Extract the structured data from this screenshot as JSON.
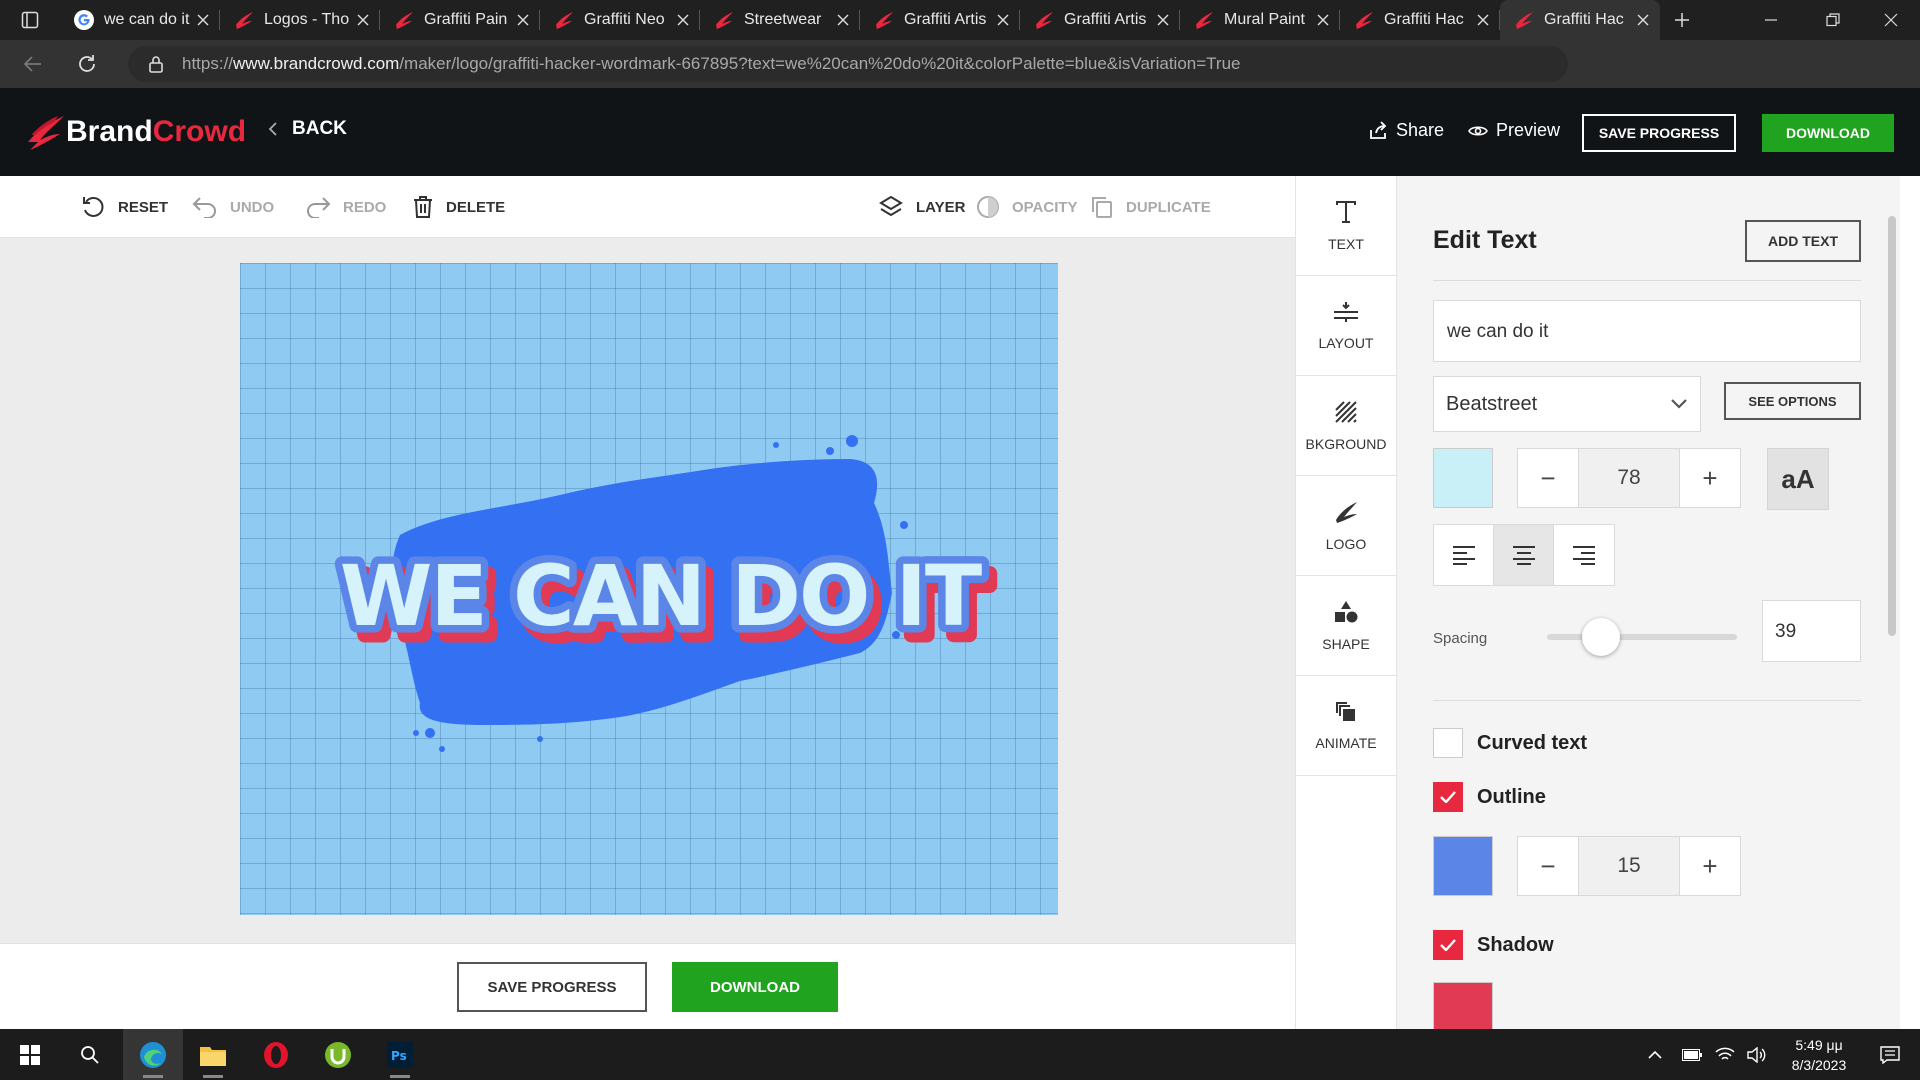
{
  "browser": {
    "tabs": [
      {
        "title": "we can do it",
        "icon": "google-g-icon",
        "active": false
      },
      {
        "title": "Logos - Tho",
        "icon": "brandcrowd-favicon-icon",
        "active": false
      },
      {
        "title": "Graffiti Pain",
        "icon": "brandcrowd-favicon-icon",
        "active": false
      },
      {
        "title": "Graffiti Neo",
        "icon": "brandcrowd-favicon-icon",
        "active": false
      },
      {
        "title": "Streetwear",
        "icon": "brandcrowd-favicon-icon",
        "active": false
      },
      {
        "title": "Graffiti Artis",
        "icon": "brandcrowd-favicon-icon",
        "active": false
      },
      {
        "title": "Graffiti Artis",
        "icon": "brandcrowd-favicon-icon",
        "active": false
      },
      {
        "title": "Mural Paint",
        "icon": "brandcrowd-favicon-icon",
        "active": false
      },
      {
        "title": "Graffiti Hac",
        "icon": "brandcrowd-favicon-icon",
        "active": false
      },
      {
        "title": "Graffiti Hac",
        "icon": "brandcrowd-favicon-icon",
        "active": true
      }
    ],
    "url_prefix": "https://",
    "url_domain": "www.brandcrowd.com",
    "url_path": "/maker/logo/graffiti-hacker-wordmark-667895?text=we%20can%20do%20it&colorPalette=blue&isVariation=True"
  },
  "header": {
    "logo_part1": "Brand",
    "logo_part2": "Crowd",
    "back_label": "BACK",
    "share_label": "Share",
    "preview_label": "Preview",
    "save_label": "SAVE PROGRESS",
    "download_label": "DOWNLOAD",
    "brand_color": "#e8283f",
    "download_color": "#20a31f"
  },
  "toolbar": {
    "reset": "RESET",
    "undo": "UNDO",
    "redo": "REDO",
    "delete": "DELETE",
    "layer": "LAYER",
    "opacity": "OPACITY",
    "duplicate": "DUPLICATE"
  },
  "canvas": {
    "logo_text": "WE CAN DO IT",
    "background_color": "#8fcaf3",
    "splash_color": "#3470f2"
  },
  "bottom": {
    "save_label": "SAVE PROGRESS",
    "download_label": "DOWNLOAD"
  },
  "rail": [
    {
      "label": "TEXT",
      "icon": "text-icon"
    },
    {
      "label": "LAYOUT",
      "icon": "layout-icon"
    },
    {
      "label": "BKGROUND",
      "icon": "background-icon"
    },
    {
      "label": "LOGO",
      "icon": "logo-icon"
    },
    {
      "label": "SHAPE",
      "icon": "shape-icon"
    },
    {
      "label": "ANIMATE",
      "icon": "animate-icon"
    }
  ],
  "panel": {
    "title": "Edit Text",
    "add_text_label": "ADD TEXT",
    "text_value": "we can do it",
    "font": "Beatstreet",
    "see_options_label": "SEE OPTIONS",
    "text_color": "#c9f0f7",
    "font_size": "78",
    "case_label": "aA",
    "alignment": "center",
    "spacing_label": "Spacing",
    "spacing_value": "39",
    "curved_label": "Curved text",
    "curved_checked": false,
    "outline_label": "Outline",
    "outline_checked": true,
    "outline_color": "#5b86e8",
    "outline_size": "15",
    "shadow_label": "Shadow",
    "shadow_checked": true,
    "shadow_color": "#e03a55"
  },
  "taskbar": {
    "time": "5:49 μμ",
    "date": "8/3/2023",
    "apps": [
      "start-icon",
      "search-icon",
      "edge-icon",
      "file-explorer-icon",
      "opera-icon",
      "utorrent-icon",
      "photoshop-icon"
    ]
  }
}
